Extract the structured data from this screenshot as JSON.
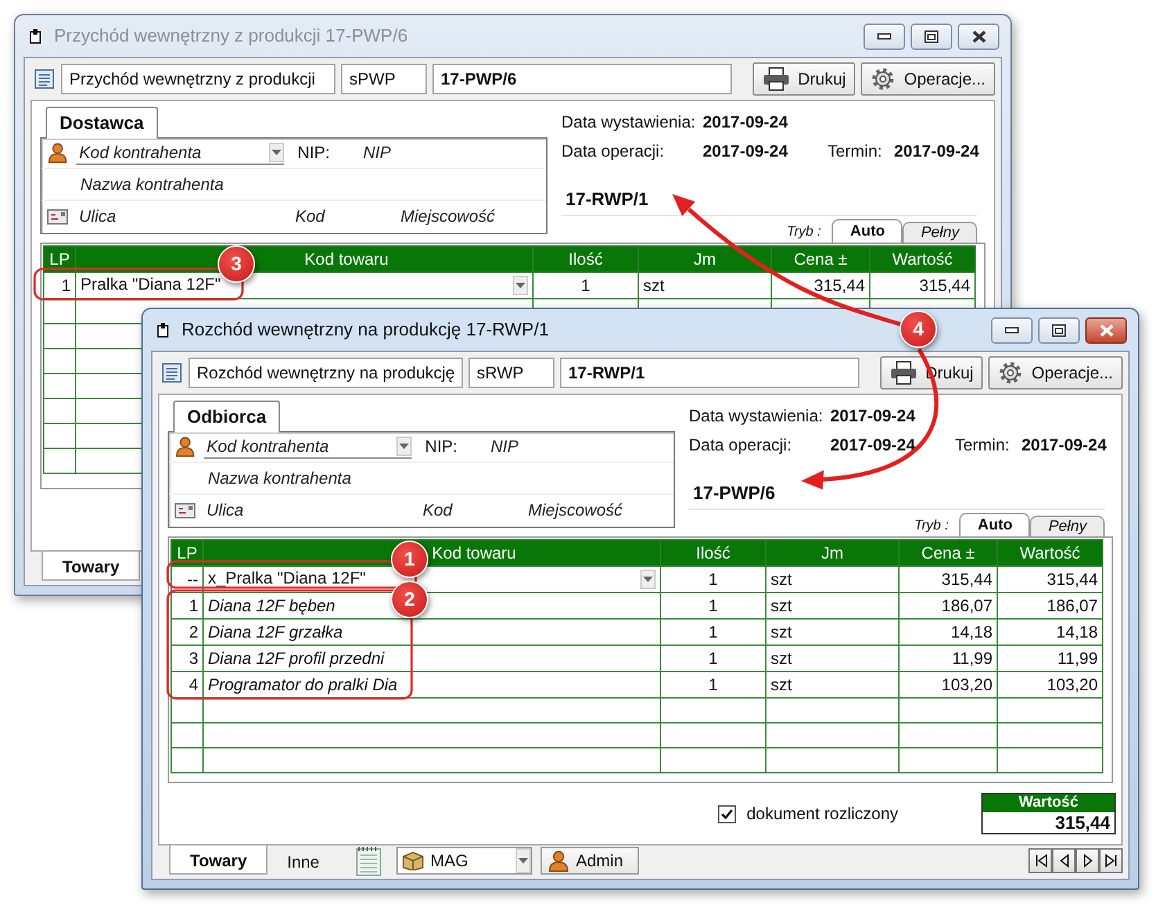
{
  "windows": [
    {
      "title": "Przychód wewnętrzny z produkcji 17-PWP/6",
      "active": false,
      "toolbar": {
        "doc_type": "Przychód wewnętrzny z produkcji",
        "series": "sPWP",
        "number": "17-PWP/6",
        "print_button": "Drukuj",
        "operations_button": "Operacje..."
      },
      "party": {
        "tab": "Dostawca",
        "code": {
          "placeholder": "Kod kontrahenta"
        },
        "nip_label": "NIP:",
        "nip": {
          "placeholder": "NIP"
        },
        "name": {
          "placeholder": "Nazwa kontrahenta"
        },
        "street": {
          "placeholder": "Ulica"
        },
        "postcode": {
          "placeholder": "Kod"
        },
        "city": {
          "placeholder": "Miejscowość"
        }
      },
      "dates": {
        "issue_label": "Data wystawienia:",
        "issue": "2017-09-24",
        "operation_label": "Data operacji:",
        "operation": "2017-09-24",
        "due_label": "Termin:",
        "due": "2017-09-24"
      },
      "linked_document": "17-RWP/1",
      "mode": {
        "label": "Tryb :",
        "tabs": [
          {
            "label": "Auto",
            "selected": true
          },
          {
            "label": "Pełny",
            "selected": false
          }
        ]
      },
      "table": {
        "columns": [
          "LP",
          "Kod towaru",
          "Ilość",
          "Jm",
          "Cena ±",
          "Wartość"
        ],
        "rows": [
          {
            "kind": "product",
            "lp": "1",
            "name": "Pralka \"Diana 12F\"",
            "qty": "1",
            "unit": "szt",
            "price": "315,44",
            "value": "315,44"
          }
        ]
      },
      "bottom_tabs": [
        {
          "label": "Towary",
          "selected": true
        }
      ]
    },
    {
      "title": "Rozchód wewnętrzny na produkcję 17-RWP/1",
      "active": true,
      "toolbar": {
        "doc_type": "Rozchód wewnętrzny na produkcję",
        "series": "sRWP",
        "number": "17-RWP/1",
        "print_button": "Drukuj",
        "operations_button": "Operacje..."
      },
      "party": {
        "tab": "Odbiorca",
        "code": {
          "placeholder": "Kod kontrahenta"
        },
        "nip_label": "NIP:",
        "nip": {
          "placeholder": "NIP"
        },
        "name": {
          "placeholder": "Nazwa kontrahenta"
        },
        "street": {
          "placeholder": "Ulica"
        },
        "postcode": {
          "placeholder": "Kod"
        },
        "city": {
          "placeholder": "Miejscowość"
        }
      },
      "dates": {
        "issue_label": "Data wystawienia:",
        "issue": "2017-09-24",
        "operation_label": "Data operacji:",
        "operation": "2017-09-24",
        "due_label": "Termin:",
        "due": "2017-09-24"
      },
      "linked_document": "17-PWP/6",
      "mode": {
        "label": "Tryb :",
        "tabs": [
          {
            "label": "Auto",
            "selected": true
          },
          {
            "label": "Pełny",
            "selected": false
          }
        ]
      },
      "table": {
        "columns": [
          "LP",
          "Kod towaru",
          "Ilość",
          "Jm",
          "Cena ±",
          "Wartość"
        ],
        "rows": [
          {
            "kind": "product",
            "lp": "--",
            "name": "x_Pralka \"Diana 12F\"",
            "qty": "1",
            "unit": "szt",
            "price": "315,44",
            "value": "315,44"
          },
          {
            "kind": "component",
            "lp": "1",
            "name": "Diana 12F bęben",
            "qty": "1",
            "unit": "szt",
            "price": "186,07",
            "value": "186,07"
          },
          {
            "kind": "component",
            "lp": "2",
            "name": "Diana 12F grzałka",
            "qty": "1",
            "unit": "szt",
            "price": "14,18",
            "value": "14,18"
          },
          {
            "kind": "component",
            "lp": "3",
            "name": "Diana 12F profil przedni",
            "qty": "1",
            "unit": "szt",
            "price": "11,99",
            "value": "11,99"
          },
          {
            "kind": "component",
            "lp": "4",
            "name": "Programator do pralki Dia",
            "qty": "1",
            "unit": "szt",
            "price": "103,20",
            "value": "103,20"
          }
        ]
      },
      "settled": {
        "label": "dokument rozliczony",
        "checked": true
      },
      "total": {
        "label": "Wartość",
        "value": "315,44"
      },
      "bottom_tabs": [
        {
          "label": "Towary",
          "selected": true
        },
        {
          "label": "Inne",
          "selected": false
        }
      ],
      "warehouse": "MAG",
      "user": "Admin"
    }
  ],
  "callouts": [
    {
      "number": "1"
    },
    {
      "number": "2"
    },
    {
      "number": "3"
    },
    {
      "number": "4"
    }
  ]
}
